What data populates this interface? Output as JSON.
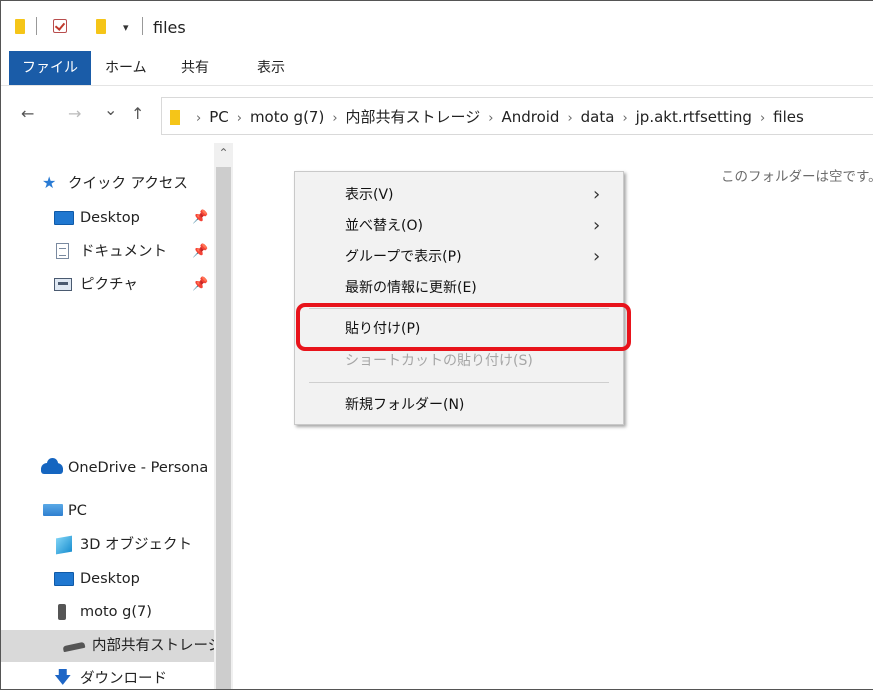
{
  "window": {
    "title": "files",
    "quick_access_dropdown": "▾",
    "colors": {
      "ribbon_active_tab": "#1a5ca8",
      "folder_icon": "#f5c518",
      "highlight_box": "#e8131b"
    }
  },
  "ribbon": {
    "tabs": [
      {
        "label": "ファイル",
        "active": true
      },
      {
        "label": "ホーム"
      },
      {
        "label": "共有"
      },
      {
        "label": "表示"
      }
    ]
  },
  "nav": {
    "back": "←",
    "forward": "→",
    "recent": "⌄",
    "up": "↑",
    "breadcrumbs": [
      "PC",
      "moto g(7)",
      "内部共有ストレージ",
      "Android",
      "data",
      "jp.akt.rtfsetting",
      "files"
    ],
    "crumb_separator": "›"
  },
  "sidebar": {
    "quick_access": {
      "label": "クイック アクセス",
      "icon": "star-icon"
    },
    "pinned": [
      {
        "label": "Desktop",
        "icon": "desktop-icon",
        "pin": "📌"
      },
      {
        "label": "ドキュメント",
        "icon": "document-icon",
        "pin": "📌"
      },
      {
        "label": "ピクチャ",
        "icon": "pictures-icon",
        "pin": "📌"
      }
    ],
    "onedrive": {
      "label": "OneDrive - Persona",
      "icon": "cloud-icon"
    },
    "pc": {
      "label": "PC",
      "icon": "pc-icon"
    },
    "pc_children": [
      {
        "label": "3D オブジェクト",
        "icon": "cube-icon"
      },
      {
        "label": "Desktop",
        "icon": "desktop-icon"
      },
      {
        "label": "moto g(7)",
        "icon": "phone-icon"
      },
      {
        "label": "内部共有ストレージ",
        "icon": "drive-icon",
        "selected": true
      },
      {
        "label": "ダウンロード",
        "icon": "download-icon"
      }
    ]
  },
  "scrollbar": {
    "up_arrow": "⌃"
  },
  "main": {
    "empty_message": "このフォルダーは空です。"
  },
  "context_menu": {
    "submenu_arrow": "›",
    "items": [
      {
        "label": "表示(V)",
        "submenu": true
      },
      {
        "label": "並べ替え(O)",
        "submenu": true
      },
      {
        "label": "グループで表示(P)",
        "submenu": true
      },
      {
        "label": "最新の情報に更新(E)"
      },
      {
        "label": "貼り付け(P)",
        "highlighted": true
      },
      {
        "label": "ショートカットの貼り付け(S)",
        "disabled": true
      },
      {
        "label": "新規フォルダー(N)"
      }
    ]
  }
}
